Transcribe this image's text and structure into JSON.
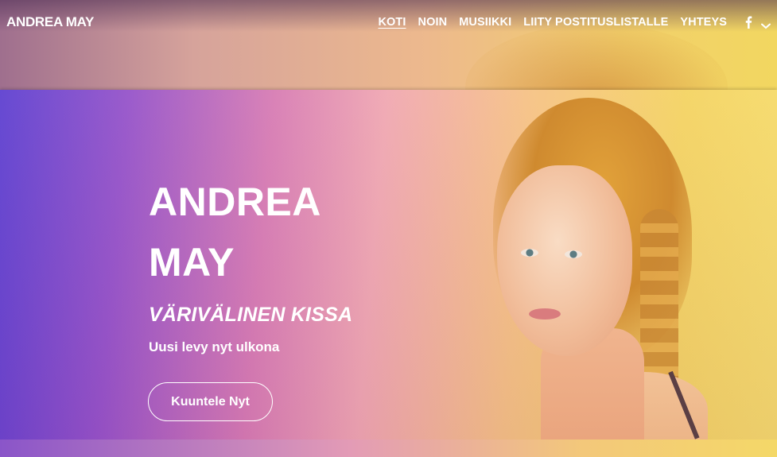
{
  "site": {
    "brand": "ANDREA MAY"
  },
  "nav": {
    "items": [
      {
        "label": "KOTI",
        "active": true
      },
      {
        "label": "NOIN",
        "active": false
      },
      {
        "label": "MUSIIKKI",
        "active": false
      },
      {
        "label": "LIITY POSTITUSLISTALLE",
        "active": false
      },
      {
        "label": "YHTEYS",
        "active": false
      }
    ],
    "social_icon": "facebook-icon",
    "more_icon": "chevron-down-icon"
  },
  "hero": {
    "name_line1": "ANDREA",
    "name_line2": "MAY",
    "album_title": "VÄRIVÄLINEN KISSA",
    "subtitle": "Uusi levy nyt ulkona",
    "cta_label": "Kuuntele Nyt"
  },
  "colors": {
    "text": "#ffffff",
    "gradient_start": "#5d3fd0",
    "gradient_mid": "#f0a7b1",
    "gradient_end": "#f6dc6a"
  }
}
